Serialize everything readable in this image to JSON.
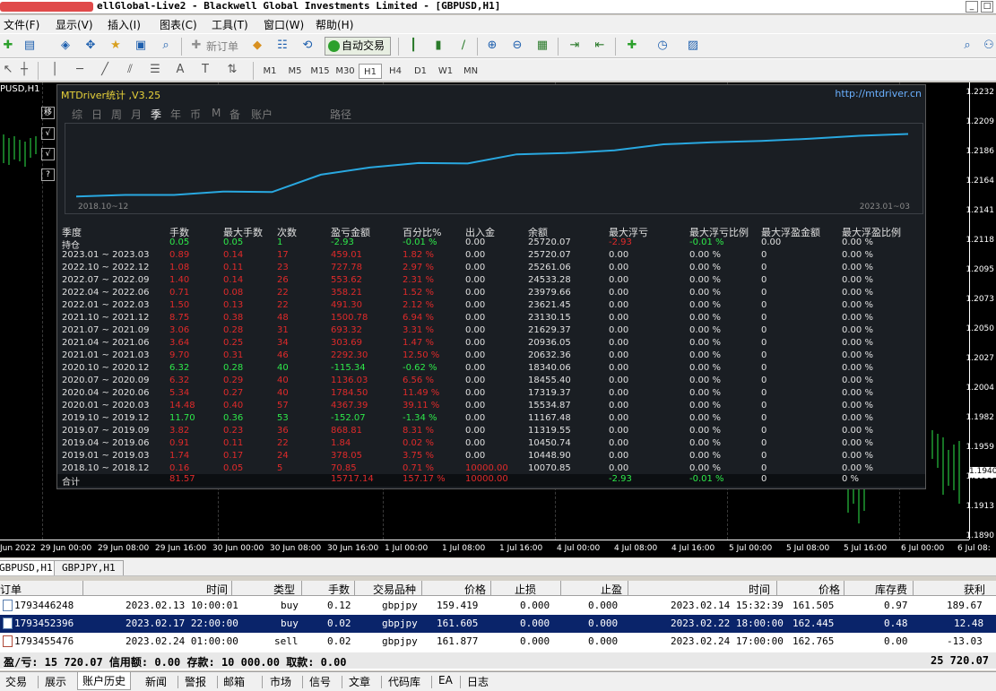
{
  "window": {
    "title": "ellGlobal-Live2 - Blackwell Global Investments Limited - [GBPUSD,H1]",
    "btn_min": "_",
    "btn_restore": "□"
  },
  "menu": [
    "文件(F)",
    "显示(V)",
    "插入(I)",
    "图表(C)",
    "工具(T)",
    "窗口(W)",
    "帮助(H)"
  ],
  "toolbar": {
    "new_order": "新订单",
    "auto_trade": "自动交易",
    "timeframes": [
      "M1",
      "M5",
      "M15",
      "M30",
      "H1",
      "H4",
      "D1",
      "W1",
      "MN"
    ],
    "active_timeframe": "H1"
  },
  "chart": {
    "symbol": "PUSD,H1",
    "prices": [
      "1.2232",
      "1.2209",
      "1.2186",
      "1.2164",
      "1.2141",
      "1.2118",
      "1.2095",
      "1.2073",
      "1.2050",
      "1.2027",
      "1.2004",
      "1.1982",
      "1.1959",
      "1.1936",
      "1.1913",
      "1.1890"
    ],
    "current_price": "1.1940",
    "times": [
      "Jun 2022",
      "29 Jun 00:00",
      "29 Jun 08:00",
      "29 Jun 16:00",
      "30 Jun 00:00",
      "30 Jun 08:00",
      "30 Jun 16:00",
      "1 Jul 00:00",
      "1 Jul 08:00",
      "1 Jul 16:00",
      "4 Jul 00:00",
      "4 Jul 08:00",
      "4 Jul 16:00",
      "5 Jul 00:00",
      "5 Jul 08:00",
      "5 Jul 16:00",
      "6 Jul 00:00",
      "6 Jul 08:"
    ],
    "side_buttons": [
      "移",
      "√",
      "√",
      "?"
    ]
  },
  "panel": {
    "title": "MTDriver统计 ,V3.25",
    "link": "http://mtdriver.cn",
    "tabs": [
      "综",
      "日",
      "周",
      "月",
      "季",
      "年",
      "币",
      "M",
      "备",
      "账户",
      "路径"
    ],
    "active_tab": "季",
    "graph_start": "2018.10~12",
    "graph_end": "2023.01~03",
    "balance_curve": [
      10070.85,
      10448.9,
      10450.74,
      11319.55,
      11167.48,
      15534.87,
      17319.37,
      18455.4,
      18340.06,
      20632.36,
      20936.05,
      21629.37,
      23130.15,
      23621.45,
      23979.66,
      24533.28,
      25261.06,
      25720.07
    ],
    "headers": [
      "季度",
      "手数",
      "最大手数",
      "次数",
      "盈亏金额",
      "百分比%",
      "出入金",
      "余额",
      "最大浮亏",
      "最大浮亏比例",
      "最大浮盈金额",
      "最大浮盈比例"
    ],
    "rows": [
      {
        "q": "持仓",
        "lots": "0.05",
        "max": "0.05",
        "cnt": "1",
        "pl": "-2.93",
        "pct": "-0.01 %",
        "io": "0.00",
        "bal": "25720.07",
        "fl": "-2.93",
        "flp": "-0.01 %",
        "fp": "0.00",
        "fpp": "0.00 %",
        "c": "g"
      },
      {
        "q": "2023.01 ~ 2023.03",
        "lots": "0.89",
        "max": "0.14",
        "cnt": "17",
        "pl": "459.01",
        "pct": "1.82 %",
        "io": "0.00",
        "bal": "25720.07",
        "fl": "0.00",
        "flp": "0.00 %",
        "fp": "0",
        "fpp": "0.00 %",
        "c": "r"
      },
      {
        "q": "2022.10 ~ 2022.12",
        "lots": "1.08",
        "max": "0.11",
        "cnt": "23",
        "pl": "727.78",
        "pct": "2.97 %",
        "io": "0.00",
        "bal": "25261.06",
        "fl": "0.00",
        "flp": "0.00 %",
        "fp": "0",
        "fpp": "0.00 %",
        "c": "r"
      },
      {
        "q": "2022.07 ~ 2022.09",
        "lots": "1.40",
        "max": "0.14",
        "cnt": "26",
        "pl": "553.62",
        "pct": "2.31 %",
        "io": "0.00",
        "bal": "24533.28",
        "fl": "0.00",
        "flp": "0.00 %",
        "fp": "0",
        "fpp": "0.00 %",
        "c": "r"
      },
      {
        "q": "2022.04 ~ 2022.06",
        "lots": "0.71",
        "max": "0.08",
        "cnt": "22",
        "pl": "358.21",
        "pct": "1.52 %",
        "io": "0.00",
        "bal": "23979.66",
        "fl": "0.00",
        "flp": "0.00 %",
        "fp": "0",
        "fpp": "0.00 %",
        "c": "r"
      },
      {
        "q": "2022.01 ~ 2022.03",
        "lots": "1.50",
        "max": "0.13",
        "cnt": "22",
        "pl": "491.30",
        "pct": "2.12 %",
        "io": "0.00",
        "bal": "23621.45",
        "fl": "0.00",
        "flp": "0.00 %",
        "fp": "0",
        "fpp": "0.00 %",
        "c": "r"
      },
      {
        "q": "2021.10 ~ 2021.12",
        "lots": "8.75",
        "max": "0.38",
        "cnt": "48",
        "pl": "1500.78",
        "pct": "6.94 %",
        "io": "0.00",
        "bal": "23130.15",
        "fl": "0.00",
        "flp": "0.00 %",
        "fp": "0",
        "fpp": "0.00 %",
        "c": "r"
      },
      {
        "q": "2021.07 ~ 2021.09",
        "lots": "3.06",
        "max": "0.28",
        "cnt": "31",
        "pl": "693.32",
        "pct": "3.31 %",
        "io": "0.00",
        "bal": "21629.37",
        "fl": "0.00",
        "flp": "0.00 %",
        "fp": "0",
        "fpp": "0.00 %",
        "c": "r"
      },
      {
        "q": "2021.04 ~ 2021.06",
        "lots": "3.64",
        "max": "0.25",
        "cnt": "34",
        "pl": "303.69",
        "pct": "1.47 %",
        "io": "0.00",
        "bal": "20936.05",
        "fl": "0.00",
        "flp": "0.00 %",
        "fp": "0",
        "fpp": "0.00 %",
        "c": "r"
      },
      {
        "q": "2021.01 ~ 2021.03",
        "lots": "9.70",
        "max": "0.31",
        "cnt": "46",
        "pl": "2292.30",
        "pct": "12.50 %",
        "io": "0.00",
        "bal": "20632.36",
        "fl": "0.00",
        "flp": "0.00 %",
        "fp": "0",
        "fpp": "0.00 %",
        "c": "r"
      },
      {
        "q": "2020.10 ~ 2020.12",
        "lots": "6.32",
        "max": "0.28",
        "cnt": "40",
        "pl": "-115.34",
        "pct": "-0.62 %",
        "io": "0.00",
        "bal": "18340.06",
        "fl": "0.00",
        "flp": "0.00 %",
        "fp": "0",
        "fpp": "0.00 %",
        "c": "g"
      },
      {
        "q": "2020.07 ~ 2020.09",
        "lots": "6.32",
        "max": "0.29",
        "cnt": "40",
        "pl": "1136.03",
        "pct": "6.56 %",
        "io": "0.00",
        "bal": "18455.40",
        "fl": "0.00",
        "flp": "0.00 %",
        "fp": "0",
        "fpp": "0.00 %",
        "c": "r"
      },
      {
        "q": "2020.04 ~ 2020.06",
        "lots": "5.34",
        "max": "0.27",
        "cnt": "40",
        "pl": "1784.50",
        "pct": "11.49 %",
        "io": "0.00",
        "bal": "17319.37",
        "fl": "0.00",
        "flp": "0.00 %",
        "fp": "0",
        "fpp": "0.00 %",
        "c": "r"
      },
      {
        "q": "2020.01 ~ 2020.03",
        "lots": "14.48",
        "max": "0.40",
        "cnt": "57",
        "pl": "4367.39",
        "pct": "39.11 %",
        "io": "0.00",
        "bal": "15534.87",
        "fl": "0.00",
        "flp": "0.00 %",
        "fp": "0",
        "fpp": "0.00 %",
        "c": "r"
      },
      {
        "q": "2019.10 ~ 2019.12",
        "lots": "11.70",
        "max": "0.36",
        "cnt": "53",
        "pl": "-152.07",
        "pct": "-1.34 %",
        "io": "0.00",
        "bal": "11167.48",
        "fl": "0.00",
        "flp": "0.00 %",
        "fp": "0",
        "fpp": "0.00 %",
        "c": "g"
      },
      {
        "q": "2019.07 ~ 2019.09",
        "lots": "3.82",
        "max": "0.23",
        "cnt": "36",
        "pl": "868.81",
        "pct": "8.31 %",
        "io": "0.00",
        "bal": "11319.55",
        "fl": "0.00",
        "flp": "0.00 %",
        "fp": "0",
        "fpp": "0.00 %",
        "c": "r"
      },
      {
        "q": "2019.04 ~ 2019.06",
        "lots": "0.91",
        "max": "0.11",
        "cnt": "22",
        "pl": "1.84",
        "pct": "0.02 %",
        "io": "0.00",
        "bal": "10450.74",
        "fl": "0.00",
        "flp": "0.00 %",
        "fp": "0",
        "fpp": "0.00 %",
        "c": "r"
      },
      {
        "q": "2019.01 ~ 2019.03",
        "lots": "1.74",
        "max": "0.17",
        "cnt": "24",
        "pl": "378.05",
        "pct": "3.75 %",
        "io": "0.00",
        "bal": "10448.90",
        "fl": "0.00",
        "flp": "0.00 %",
        "fp": "0",
        "fpp": "0.00 %",
        "c": "r"
      },
      {
        "q": "2018.10 ~ 2018.12",
        "lots": "0.16",
        "max": "0.05",
        "cnt": "5",
        "pl": "70.85",
        "pct": "0.71 %",
        "io": "10000.00",
        "bal": "10070.85",
        "fl": "0.00",
        "flp": "0.00 %",
        "fp": "0",
        "fpp": "0.00 %",
        "c": "r"
      }
    ],
    "total": {
      "q": "合计",
      "lots": "81.57",
      "pl": "15717.14",
      "pct": "157.17 %",
      "io": "10000.00",
      "fl": "-2.93",
      "flp": "-0.01 %",
      "fp": "0",
      "fpp": "0 %"
    }
  },
  "chart_tabs": [
    "GBPUSD,H1",
    "GBPJPY,H1"
  ],
  "terminal": {
    "headers": [
      "订单",
      "时间",
      "类型",
      "手数",
      "交易品种",
      "价格",
      "止损",
      "止盈",
      "时间",
      "价格",
      "库存费",
      "获利"
    ],
    "rows": [
      {
        "order": "1793446248",
        "time": "2023.02.13 10:00:01",
        "type": "buy",
        "lots": "0.12",
        "sym": "gbpjpy",
        "price": "159.419",
        "sl": "0.000",
        "tp": "0.000",
        "ctime": "2023.02.14 15:32:39",
        "cprice": "161.505",
        "swap": "0.97",
        "profit": "189.67",
        "kind": "buy"
      },
      {
        "order": "1793452396",
        "time": "2023.02.17 22:00:00",
        "type": "buy",
        "lots": "0.02",
        "sym": "gbpjpy",
        "price": "161.605",
        "sl": "0.000",
        "tp": "0.000",
        "ctime": "2023.02.22 18:00:00",
        "cprice": "162.445",
        "swap": "0.48",
        "profit": "12.48",
        "kind": "buy"
      },
      {
        "order": "1793455476",
        "time": "2023.02.24 01:00:00",
        "type": "sell",
        "lots": "0.02",
        "sym": "gbpjpy",
        "price": "161.877",
        "sl": "0.000",
        "tp": "0.000",
        "ctime": "2023.02.24 17:00:00",
        "cprice": "162.765",
        "swap": "0.00",
        "profit": "-13.03",
        "kind": "sell"
      }
    ],
    "summary": "盈/亏: 15 720.07  信用额: 0.00  存款: 10 000.00  取款: 0.00",
    "summary_total": "25 720.07"
  },
  "bottom_tabs": [
    "交易",
    "展示",
    "账户历史",
    "新闻",
    "警报",
    "邮箱",
    "市场",
    "信号",
    "文章",
    "代码库",
    "EA",
    "日志"
  ],
  "active_bottom_tab": "账户历史",
  "colors": {
    "green": "#2ee84a",
    "red": "#e02a2a",
    "curve": "#29a8e0"
  }
}
